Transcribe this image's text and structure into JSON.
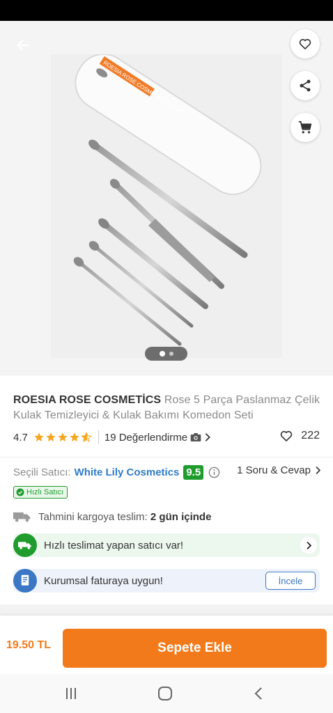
{
  "gallery": {
    "package_label": "ROESIA ROSE COSMETICS TOOLS",
    "current_image": 1,
    "image_count": 2
  },
  "product": {
    "brand": "ROESIA ROSE COSMETİCS",
    "name": "Rose 5 Parça Paslanmaz Çelik Kulak Temizleyici & Kulak Bakımı Komedon Seti",
    "rating": "4.7",
    "stars_value": 4.7,
    "reviews": "19 Değerlendirme",
    "favorites": "222"
  },
  "seller": {
    "label": "Seçili Satıcı:",
    "name": "White Lily Cosmetics",
    "score": "9.5",
    "qa": "1 Soru & Cevap",
    "badge": "Hızlı Satıcı"
  },
  "shipping": {
    "label": "Tahmini kargoya teslim:",
    "value": "2 gün içinde"
  },
  "banners": {
    "fast_delivery": "Hızlı teslimat yapan satıcı var!",
    "corporate_invoice": "Kurumsal faturaya uygun!",
    "inspect_button": "İncele"
  },
  "purchase": {
    "price": "19.50 TL",
    "add_to_cart": "Sepete Ekle"
  },
  "colors": {
    "brand_orange": "#f27a1a",
    "seller_blue": "#2f7cc8",
    "score_green": "#1f9c2d",
    "star_orange": "#f5a623"
  },
  "icons": {
    "back": "arrow-left-icon",
    "favorite": "heart-icon",
    "share": "share-icon",
    "cart": "cart-icon",
    "camera": "camera-icon",
    "truck": "truck-icon",
    "invoice": "invoice-icon"
  }
}
